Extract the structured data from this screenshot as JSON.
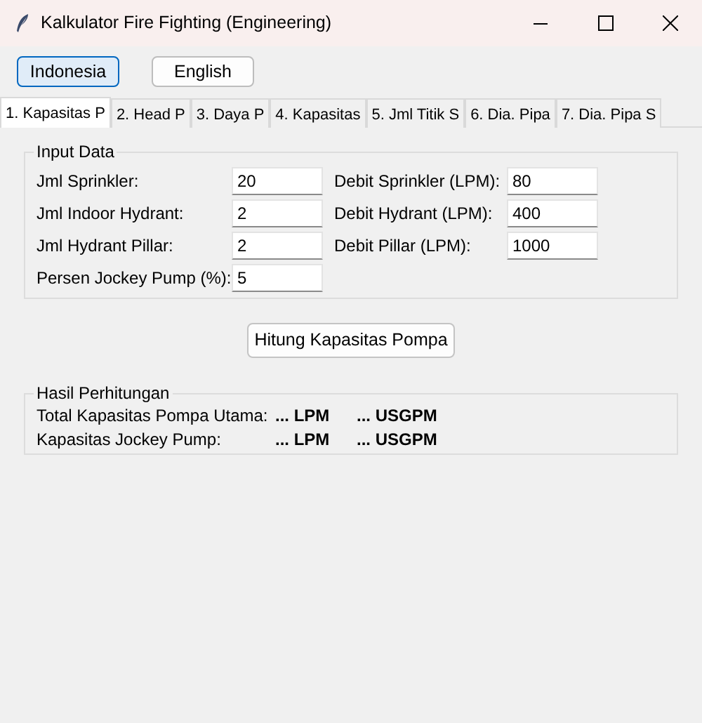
{
  "window": {
    "title": "Kalkulator Fire Fighting (Engineering)"
  },
  "language_buttons": [
    {
      "label": "Indonesia",
      "selected": true
    },
    {
      "label": "English",
      "selected": false
    }
  ],
  "tabs": [
    {
      "label": "1. Kapasitas P",
      "selected": true
    },
    {
      "label": "2. Head P",
      "selected": false
    },
    {
      "label": "3. Daya P",
      "selected": false
    },
    {
      "label": "4. Kapasitas",
      "selected": false
    },
    {
      "label": "5. Jml Titik S",
      "selected": false
    },
    {
      "label": "6. Dia. Pipa",
      "selected": false
    },
    {
      "label": "7. Dia. Pipa S",
      "selected": false
    }
  ],
  "input_group": {
    "title": "Input Data",
    "rows": [
      {
        "label": "Jml Sprinkler:",
        "value": "20",
        "label_2": "Debit Sprinkler (LPM):",
        "value_2": "80"
      },
      {
        "label": "Jml Indoor Hydrant:",
        "value": "2",
        "label_2": "Debit Hydrant (LPM):",
        "value_2": "400"
      },
      {
        "label": "Jml Hydrant Pillar:",
        "value": "2",
        "label_2": "Debit Pillar (LPM):",
        "value_2": "1000"
      },
      {
        "label": "Persen Jockey Pump (%):",
        "value": "5"
      }
    ]
  },
  "calculate_button": "Hitung Kapasitas Pompa",
  "result_group": {
    "title": "Hasil Perhitungan",
    "rows": [
      {
        "label": "Total Kapasitas Pompa Utama:",
        "lpm": "... LPM",
        "usgpm": "... USGPM"
      },
      {
        "label": "Kapasitas Jockey Pump:",
        "lpm": "... LPM",
        "usgpm": "... USGPM"
      }
    ]
  }
}
